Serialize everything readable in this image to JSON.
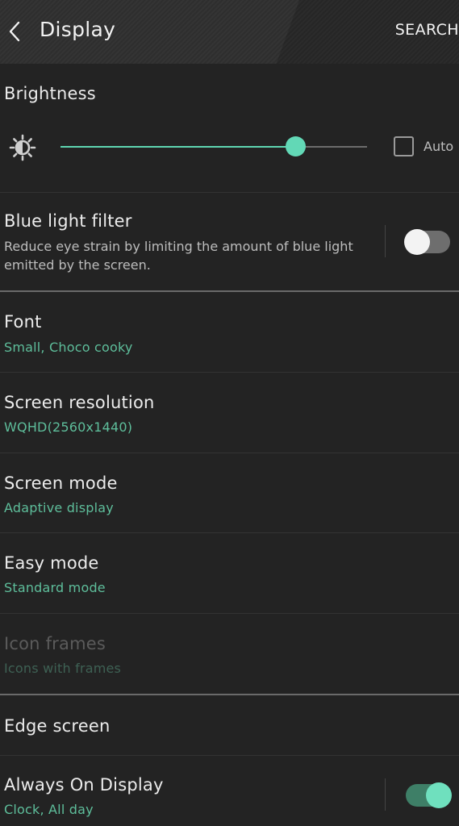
{
  "header": {
    "title": "Display",
    "search_label": "SEARCH"
  },
  "brightness": {
    "title": "Brightness",
    "level_fraction": 0.765,
    "auto_label": "Auto",
    "auto_checked": false
  },
  "blue_light": {
    "title": "Blue light filter",
    "description": "Reduce eye strain by limiting the amount of blue light emitted by the screen.",
    "enabled": false
  },
  "items": [
    {
      "title": "Font",
      "subtitle": "Small, Choco cooky"
    },
    {
      "title": "Screen resolution",
      "subtitle": "WQHD(2560x1440)"
    },
    {
      "title": "Screen mode",
      "subtitle": "Adaptive display"
    },
    {
      "title": "Easy mode",
      "subtitle": "Standard mode"
    },
    {
      "title": "Icon frames",
      "subtitle": "Icons with frames",
      "disabled": true
    }
  ],
  "edge_screen": {
    "title": "Edge screen"
  },
  "always_on": {
    "title": "Always On Display",
    "subtitle": "Clock, All day",
    "enabled": true
  },
  "colors": {
    "accent": "#5fd6b1",
    "subtitle": "#5ebe9b",
    "background": "#232323"
  }
}
